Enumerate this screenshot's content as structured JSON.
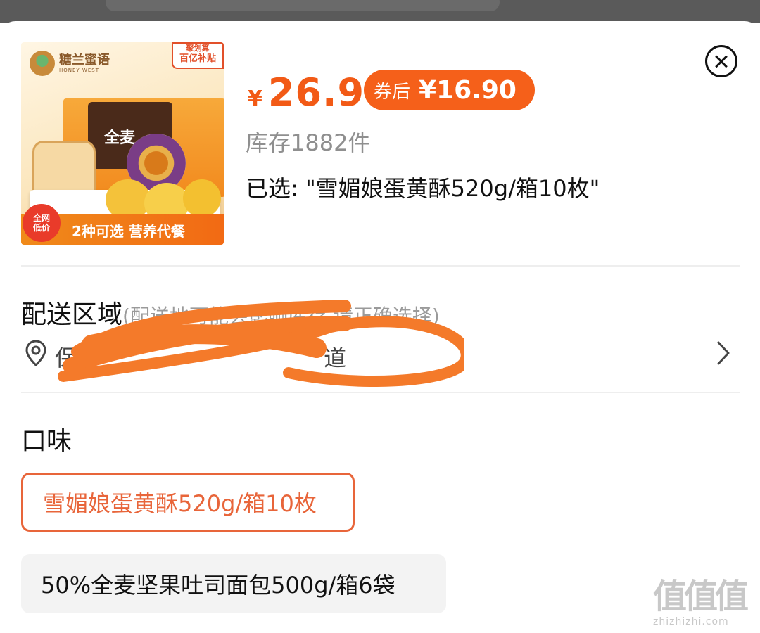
{
  "product": {
    "image_brand": "糖兰蜜语",
    "image_brand_sub": "HONEY WEST",
    "image_badge_top": "聚划算",
    "image_badge_main": "百亿补贴",
    "image_box_text": "全麦",
    "image_corner": "全网低价",
    "image_bottom_text": "2种可选 营养代餐",
    "currency": "¥",
    "price": "26.9",
    "coupon_label": "券后",
    "coupon_price": "¥16.90",
    "stock": "库存1882件",
    "selected": "已选: \"雪媚娘蛋黄酥520g/箱10枚\""
  },
  "delivery": {
    "title": "配送区域",
    "hint": "(配送地可能会影响库存,请正确选择)",
    "address_visible_start": "保",
    "address_visible_end": "道"
  },
  "flavor": {
    "title": "口味",
    "options": [
      {
        "label": "雪媚娘蛋黄酥520g/箱10枚",
        "selected": true
      },
      {
        "label": "50%全麦坚果吐司面包500g/箱6袋",
        "selected": false
      }
    ]
  },
  "watermark": {
    "glyphs": "值值值",
    "url": "zhizhizhi.com"
  },
  "colors": {
    "accent": "#f25a16",
    "selected_border": "#e8653a",
    "redaction": "#f47a2a",
    "muted_text": "#8f8f8f"
  },
  "icons": {
    "close": "close-circle-icon",
    "location": "map-pin-icon",
    "chevron": "chevron-right-icon"
  }
}
